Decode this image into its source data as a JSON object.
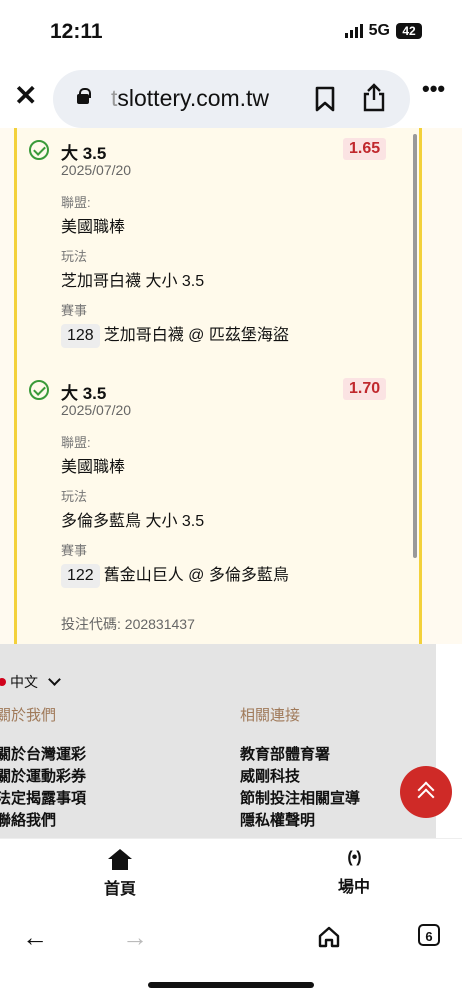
{
  "status": {
    "time": "12:11",
    "network": "5G",
    "battery": "42"
  },
  "browser": {
    "url_prefix": "t",
    "url_main": "slottery.com.tw"
  },
  "bets": [
    {
      "pick": "大 3.5",
      "date": "2025/07/20",
      "odds": "1.65",
      "league_label": "聯盟:",
      "league": "美國職棒",
      "play_label": "玩法",
      "play": "芝加哥白襪 大小 3.5",
      "event_label": "賽事",
      "event_no": "128",
      "event": "芝加哥白襪 @ 匹茲堡海盜"
    },
    {
      "pick": "大 3.5",
      "date": "2025/07/20",
      "odds": "1.70",
      "league_label": "聯盟:",
      "league": "美國職棒",
      "play_label": "玩法",
      "play": "多倫多藍鳥 大小 3.5",
      "event_label": "賽事",
      "event_no": "122",
      "event": "舊金山巨人 @ 多倫多藍鳥"
    }
  ],
  "bet_code": "投注代碼: 202831437",
  "footer": {
    "language": "中文",
    "about_heading": "關於我們",
    "about_links": [
      "關於台灣運彩",
      "關於運動彩券",
      "法定揭露事項",
      "聯絡我們"
    ],
    "related_heading": "相關連接",
    "related_links": [
      "教育部體育署",
      "威剛科技",
      "節制投注相關宣導",
      "隱私權聲明"
    ]
  },
  "bottom_nav": {
    "home": "首頁",
    "live": "場中"
  },
  "tab_count": "6",
  "colors": {
    "accent_red": "#cf2a27",
    "card_border": "#f3d13b",
    "success_green": "#3a9a3a"
  }
}
